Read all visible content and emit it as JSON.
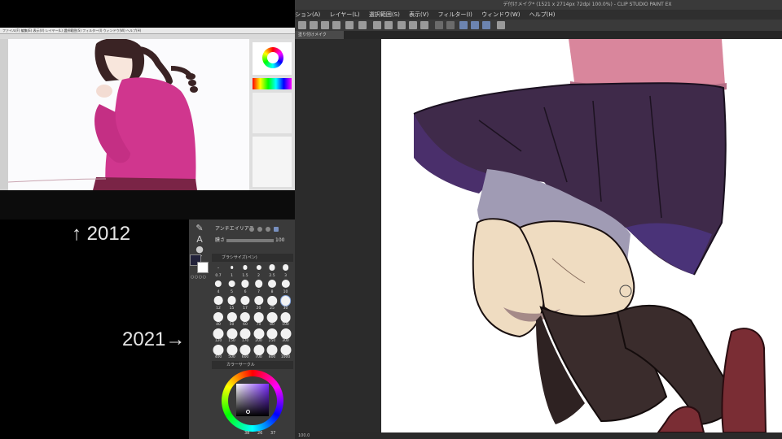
{
  "labels": {
    "year_old": "↑ 2012",
    "year_new": "2021→"
  },
  "old_app": {
    "menu_text": "ファイル(F)  編集(E)  表示(V)  レイヤー(L)  選択範囲(S)  フィルター(I)  ウィンドウ(W)  ヘルプ(H)"
  },
  "new_app": {
    "title": "デ付けメイク* (1521 x 2714px 72dpi 100.0%) - CLIP STUDIO PAINT EX",
    "menu": [
      "ション(A)",
      "レイヤー(L)",
      "選択範囲(S)",
      "表示(V)",
      "フィルター(I)",
      "ウィンドウ(W)",
      "ヘルプ(H)"
    ],
    "tab_label": "塗り付けメイク",
    "zoom": "100.0",
    "antialias_label": "アンチエイリアス",
    "thickness_label": "膜さ",
    "thickness_value": "100",
    "brush_panel_title": "ブラシサイズ(ペン)",
    "brush_sizes": [
      "0.7",
      "1",
      "1.5",
      "2",
      "2.5",
      "3",
      "4",
      "5",
      "6",
      "7",
      "8",
      "10",
      "12",
      "15",
      "17",
      "20",
      "25",
      "30",
      "40",
      "50",
      "60",
      "70",
      "80",
      "100",
      "120",
      "150",
      "170",
      "200",
      "250",
      "300",
      "400",
      "500",
      "600",
      "700",
      "800",
      "1000"
    ],
    "color_panel_title": "カラーサークル",
    "color_values": [
      "38",
      "26",
      "37"
    ]
  },
  "colors": {
    "skirt": "#3f2a4a",
    "sweater": "#d9869c",
    "skin": "#efdcc1",
    "socks": "#3a2c2c",
    "shoes": "#7a2d34",
    "main_color": "#22223a",
    "sub_color": "#ffffff"
  }
}
